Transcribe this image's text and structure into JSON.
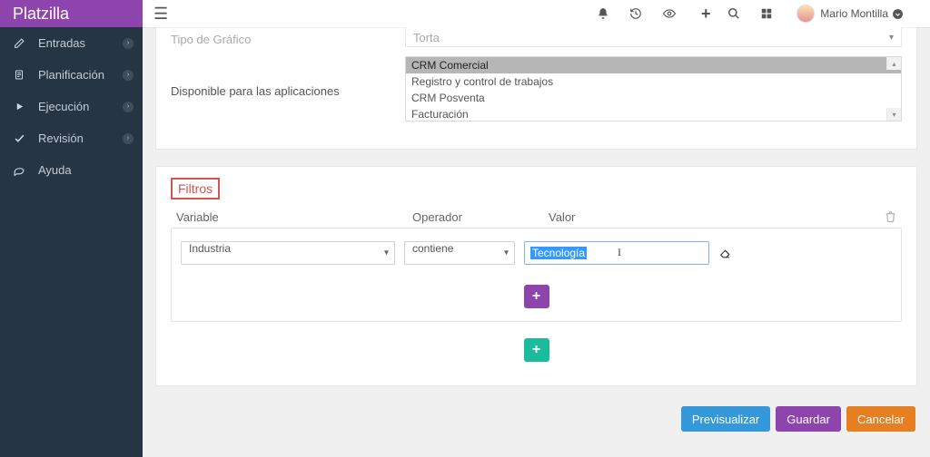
{
  "brand": "Platzilla",
  "sidebar": {
    "items": [
      {
        "label": "Entradas",
        "icon": "edit"
      },
      {
        "label": "Planificación",
        "icon": "file"
      },
      {
        "label": "Ejecución",
        "icon": "play"
      },
      {
        "label": "Revisión",
        "icon": "check"
      },
      {
        "label": "Ayuda",
        "icon": "chat"
      }
    ]
  },
  "header": {
    "username": "Mario Montilla"
  },
  "form": {
    "tipo_grafico_label": "Tipo de Gráfico",
    "tipo_grafico_value": "Torta",
    "disponible_label": "Disponible para las aplicaciones",
    "apps": [
      {
        "label": "CRM Comercial",
        "selected": true
      },
      {
        "label": "Registro y control de trabajos",
        "selected": false
      },
      {
        "label": "CRM Posventa",
        "selected": false
      },
      {
        "label": "Facturación",
        "selected": false
      }
    ]
  },
  "filters": {
    "title": "Filtros",
    "headers": {
      "variable": "Variable",
      "operador": "Operador",
      "valor": "Valor"
    },
    "rows": [
      {
        "variable": "Industria",
        "operador": "contiene",
        "valor": "Tecnología"
      }
    ]
  },
  "buttons": {
    "preview": "Previsualizar",
    "save": "Guardar",
    "cancel": "Cancelar",
    "add_inner": "+",
    "add_outer": "+"
  }
}
